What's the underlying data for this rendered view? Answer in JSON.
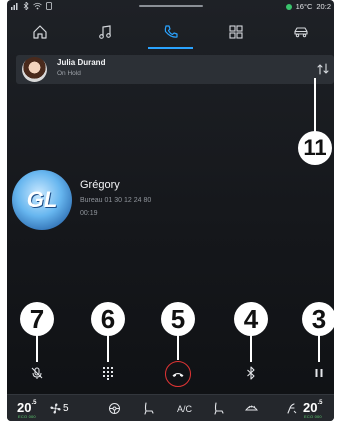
{
  "status_bar": {
    "left_icons": [
      "signal-icon",
      "bluetooth-icon",
      "wifi-icon",
      "phone-small-icon"
    ],
    "temperature": "16°C",
    "time": "20:2"
  },
  "nav": {
    "items": [
      {
        "name": "home",
        "icon": "home-icon"
      },
      {
        "name": "music",
        "icon": "music-icon"
      },
      {
        "name": "phone",
        "icon": "phone-icon",
        "active": true
      },
      {
        "name": "apps",
        "icon": "apps-grid-icon"
      },
      {
        "name": "car",
        "icon": "car-icon"
      }
    ],
    "accent": "#2aa3ff"
  },
  "on_hold": {
    "name": "Julia Durand",
    "status": "On Hold"
  },
  "active_call": {
    "name": "Grégory",
    "detail": "Bureau 01 30 12 24 80",
    "duration": "00:19",
    "avatar_text": "GL"
  },
  "callouts": {
    "c11": "11",
    "c7": "7",
    "c6": "6",
    "c5": "5",
    "c4": "4",
    "c3": "3"
  },
  "actions": [
    {
      "name": "mute",
      "icon": "mic-off-icon"
    },
    {
      "name": "keypad",
      "icon": "keypad-icon"
    },
    {
      "name": "hang-up",
      "icon": "hang-up-icon",
      "color": "#e03434"
    },
    {
      "name": "bluetooth-audio",
      "icon": "bluetooth-icon"
    },
    {
      "name": "hold",
      "icon": "pause-icon"
    }
  ],
  "climate": {
    "left_temp": "20",
    "left_temp_unit": ".5",
    "left_eco": "ECO 000",
    "fan_speed": "5",
    "ac_label": "A/C",
    "right_temp": "20",
    "right_temp_unit": ".5",
    "right_eco": "ECO 000",
    "eco_color": "#5fcf72"
  }
}
